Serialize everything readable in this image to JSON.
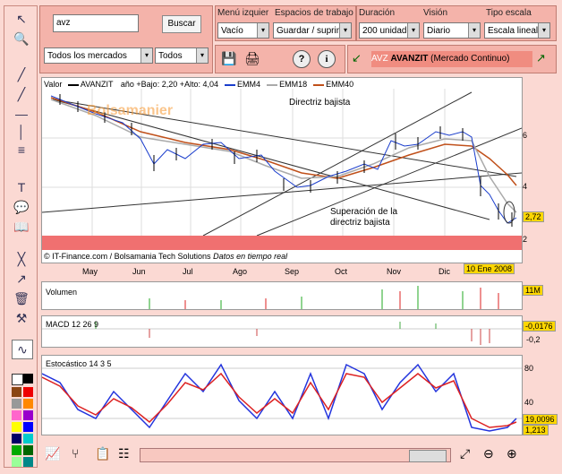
{
  "search": {
    "value": "avz",
    "button": "Buscar"
  },
  "filters": {
    "market": "Todos los mercados",
    "type": "Todos"
  },
  "menus": {
    "menu_izq_label": "Menú izquier",
    "menu_izq_value": "Vacío",
    "workspace_label": "Espacios de trabajo",
    "workspace_value": "Guardar / suprimir",
    "duration_label": "Duración",
    "duration_value": "200 unidades",
    "view_label": "Visión",
    "view_value": "Diario",
    "scale_label": "Tipo escala",
    "scale_value": "Escala lineal"
  },
  "ticker": {
    "code": "AVZ",
    "name": "AVANZIT",
    "market": "(Mercado Continuo)"
  },
  "main_chart": {
    "legend": [
      "Valor",
      "AVANZIT",
      "año +Bajo: 2,20 +Alto: 4,04",
      "EMM4",
      "EMM18",
      "EMM40"
    ],
    "annotation1": "Directriz bajista",
    "annotation2": "Superación de la",
    "annotation3": "directriz bajista",
    "credit": "© IT-Finance.com / Bolsamania Tech Solutions",
    "credit_italic": "Datos en tiempo real",
    "watermark": "Bolsamanier",
    "price_tag": "2,72",
    "date_tag": "10 Ene 2008",
    "yticks": [
      "6",
      "4",
      "2"
    ],
    "months": [
      "May",
      "Jun",
      "Jul",
      "Ago",
      "Sep",
      "Oct",
      "Nov",
      "Dic"
    ],
    "colors": {
      "emm4": "#1a3dcc",
      "emm18": "#aaaaaa",
      "emm40": "#c0501a"
    }
  },
  "volume": {
    "label": "Volumen",
    "value": "11M"
  },
  "macd": {
    "label": "MACD 12 26 9",
    "value": "-0,0176",
    "tick": "-0,2"
  },
  "stoch": {
    "label": "Estocástico 14 3 5",
    "ticks": [
      "80",
      "40",
      "0"
    ],
    "value1": "19,0096",
    "value2": "1,213"
  }
}
